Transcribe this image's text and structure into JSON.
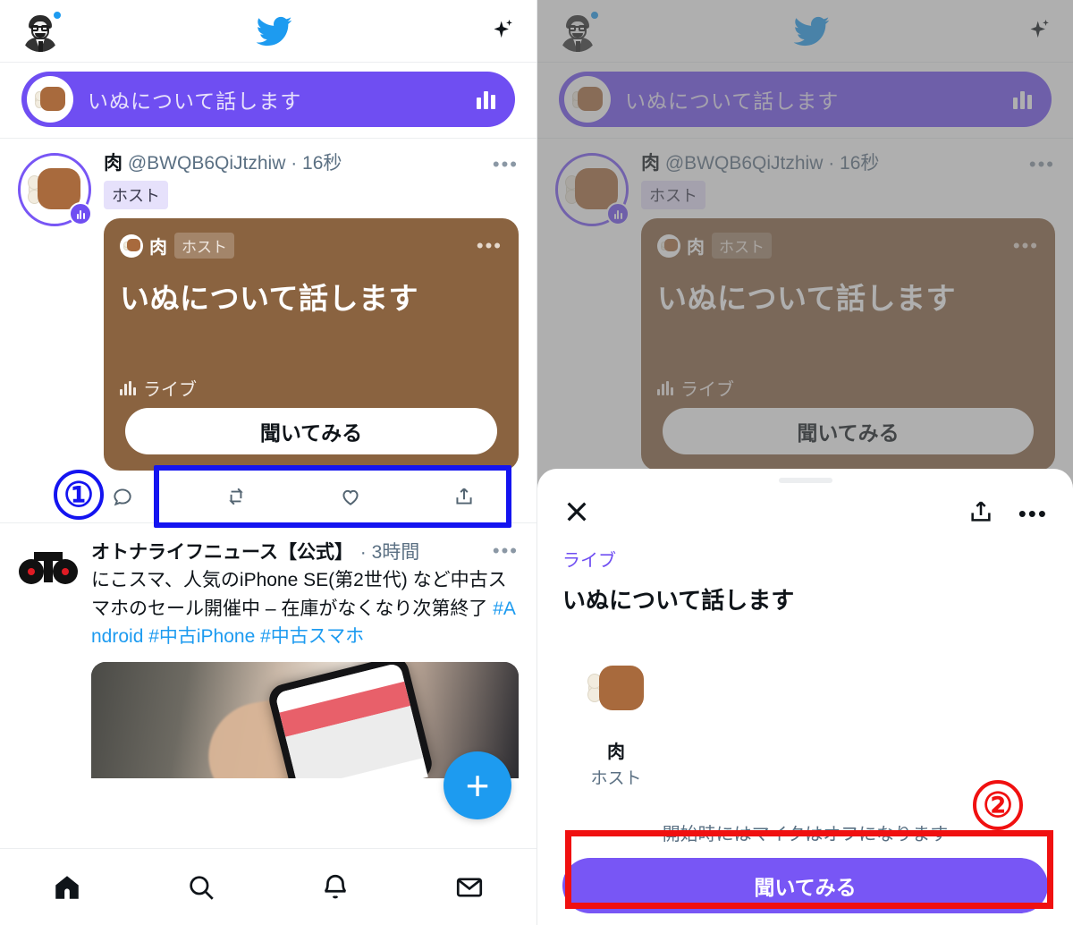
{
  "left": {
    "topbar": {
      "avatar_name": "profile-avatar",
      "logo_name": "twitter-bird",
      "sparkle_name": "sparkle"
    },
    "spaces_bar": {
      "title": "いぬについて話します"
    },
    "tweet": {
      "display_name": "肉",
      "handle": "@BWQB6QiJtzhiw",
      "separator": " · ",
      "time": "16秒",
      "more": "•••",
      "host_badge": "ホスト",
      "card": {
        "host_name": "肉",
        "host_badge": "ホスト",
        "more": "•••",
        "title": "いぬについて話します",
        "live_label": "ライブ",
        "listen_button": "聞いてみる"
      }
    },
    "tweet2": {
      "display_name": "オトナライフニュース【公式】",
      "time": "· 3時間",
      "more": "•••",
      "text_part1": "にこスマ、人気のiPhone SE(第2世代) など中古スマホのセール開催中 – 在庫がなくなり次第終了 ",
      "hashtags": "#Android #中古iPhone #中古スマホ",
      "logo_text": "OTO"
    },
    "compose_button": "+",
    "nav": [
      {
        "name": "home-icon",
        "label": "ホーム"
      },
      {
        "name": "search-icon",
        "label": "検索"
      },
      {
        "name": "notifications-icon",
        "label": "通知"
      },
      {
        "name": "messages-icon",
        "label": "メッセージ"
      }
    ]
  },
  "right": {
    "sheet": {
      "close": "×",
      "share": "share-icon",
      "more": "•••",
      "live_label": "ライブ",
      "title": "いぬについて話します",
      "person_name": "肉",
      "person_role": "ホスト",
      "mic_note": "開始時にはマイクはオフになります",
      "join_button": "聞いてみる"
    }
  },
  "annotations": {
    "step1": "①",
    "step2": "②",
    "step1_color": "#1414f0",
    "step2_color": "#f01010"
  },
  "colors": {
    "twitter_blue": "#1d9bf0",
    "spaces_purple": "#6f4ef2",
    "button_purple": "#7856f5",
    "card_brown": "#8a6340"
  }
}
